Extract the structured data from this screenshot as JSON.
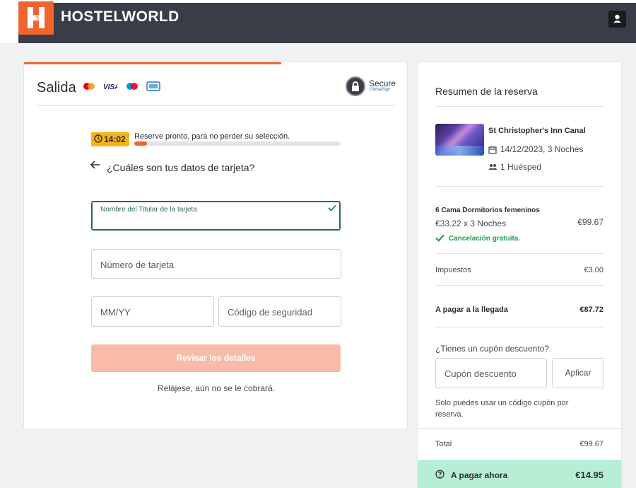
{
  "header": {
    "brand": "HOSTELWORLD",
    "logo_letter": "H",
    "user_icon": "user-icon"
  },
  "checkout": {
    "title": "Salida",
    "payment_logos": [
      "mastercard-icon",
      "visa-icon",
      "maestro-icon",
      "card-icon"
    ],
    "secure_label": "Secure",
    "secure_sub": "GlobalSign",
    "timer": "14:02",
    "timer_text": "Reserve pronto, para no perder su selección.",
    "timer_progress": 0.06,
    "question": "¿Cuáles son tus datos de tarjeta?",
    "fields": {
      "name_label": "Nombre del Titular de la tarjeta",
      "name_value": "",
      "number_placeholder": "Número de tarjeta",
      "expiry_placeholder": "MM/YY",
      "cvv_placeholder": "Código de seguridad"
    },
    "review_button": "Revisar los detalles",
    "relax_note": "Relájese, aún no se le cobrará."
  },
  "summary": {
    "title": "Resumen de la reserva",
    "hostel_name": "St Christopher's Inn Canal",
    "dates": "14/12/2023, 3 Noches",
    "guests": "1 Huésped",
    "room_name": "6 Cama Dormitorios femeninos",
    "room_price": "€33.22 x 3 Noches",
    "room_total": "€99.67",
    "cancellation": "Cancelación gratuita.",
    "taxes_label": "Impuestos",
    "taxes_value": "€3.00",
    "arrival_label": "A pagar a la llegada",
    "arrival_value": "€87.72",
    "coupon_question": "¿Tienes un cupón descuento?",
    "coupon_placeholder": "Cupón descuento",
    "apply_button": "Aplicar",
    "coupon_note": "Solo puedes usar un código cupón por reserva.",
    "total_label": "Total",
    "total_value": "€99.67",
    "pay_now_label": "A pagar ahora",
    "pay_now_value": "€14.95"
  },
  "colors": {
    "brand_orange": "#f1642e",
    "header_dark": "#393d47",
    "timer_yellow": "#f7b21a",
    "success_green": "#1e9c4f",
    "pay_now_bg": "#b7efd4",
    "button_disabled": "#f8bba8"
  }
}
